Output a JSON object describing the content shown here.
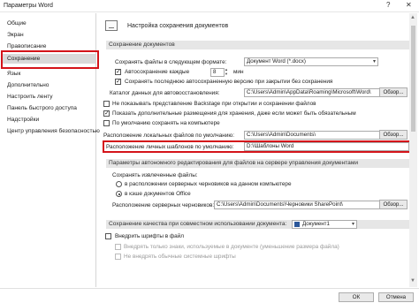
{
  "window": {
    "title": "Параметры Word",
    "help_glyph": "?",
    "close_glyph": "✕"
  },
  "sidebar": {
    "items": [
      {
        "label": "Общие"
      },
      {
        "label": "Экран"
      },
      {
        "label": "Правописание"
      },
      {
        "label": "Сохранение"
      },
      {
        "label": "Язык"
      },
      {
        "label": "Дополнительно"
      },
      {
        "label": "Настроить ленту"
      },
      {
        "label": "Панель быстрого доступа"
      },
      {
        "label": "Надстройки"
      },
      {
        "label": "Центр управления безопасностью"
      }
    ],
    "selected_index": 3
  },
  "header": {
    "title": "Настройка сохранения документов",
    "icon": "document-save-icon"
  },
  "save_section": {
    "title": "Сохранение документов",
    "format_label": "Сохранять файлы в следующем формате:",
    "format_value": "Документ Word (*.docx)",
    "autosave_label": "Автосохранение каждые",
    "autosave_value": "8",
    "autosave_unit": "мин",
    "keep_last_label": "Сохранять последнюю автосохраненную версию при закрытии без сохранения",
    "autorecover_label": "Каталог данных для автовосстановления:",
    "autorecover_value": "C:\\Users\\Admin\\AppData\\Roaming\\Microsoft\\Word\\",
    "browse_label": "Обзор...",
    "no_backstage_label": "Не показывать представление Backstage при открытии и сохранении файлов",
    "show_places_label": "Показать дополнительные размещения для хранения, даже если может быть обязательным",
    "default_local_label": "По умолчанию сохранять на компьютере",
    "local_files_label": "Расположение локальных файлов по умолчанию:",
    "local_files_value": "C:\\Users\\Admin\\Documents\\",
    "templates_label": "Расположение личных шаблонов по умолчанию:",
    "templates_value": "D:\\\\Шаблоны Word"
  },
  "server_section": {
    "title": "Параметры автономного редактирования для файлов на сервере управления документами",
    "save_checked_label": "Сохранять извлеченные файлы:",
    "radio_server_label": "в расположении серверных черновиков на данном компьютере",
    "radio_office_label": "в кэше документов Office",
    "drafts_label": "Расположение серверных черновиков:",
    "drafts_value": "C:\\Users\\Admin\\Documents\\Черновики SharePoint\\",
    "browse_label": "Обзор..."
  },
  "quality_section": {
    "title": "Сохранение качества при совместном использовании документа:",
    "doc_value": "Документ1",
    "embed_fonts_label": "Внедрить шрифты в файл",
    "embed_used_label": "Внедрять только знаки, используемые в документе (уменьшение размера файла)",
    "no_common_label": "Не внедрять обычные системные шрифты"
  },
  "footer": {
    "ok_label": "ОК",
    "cancel_label": "Отмена"
  },
  "colors": {
    "highlight_red": "#d4141a",
    "selected_bg": "#d9d9d9",
    "section_bg": "#e6e6e6"
  }
}
